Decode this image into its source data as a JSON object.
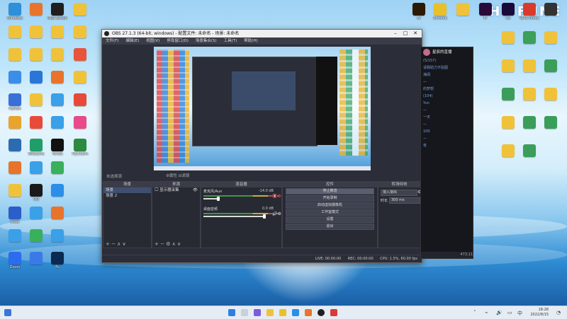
{
  "brand_text": "THE FUNE",
  "desktop_icons": [
    {
      "label": "Windows",
      "color": "#2f8fd8"
    },
    {
      "label": "",
      "color": "#e8742c"
    },
    {
      "label": "OBS Studio",
      "color": "#1f1f1f"
    },
    {
      "label": "",
      "color": "#f0c23a"
    },
    {
      "label": "",
      "color": "#f0c23a"
    },
    {
      "label": "",
      "color": "#f0c23a"
    },
    {
      "label": "",
      "color": "#f0c23a"
    },
    {
      "label": "",
      "color": "#f0c23a"
    },
    {
      "label": "",
      "color": "#f0c23a"
    },
    {
      "label": "",
      "color": "#f0c23a"
    },
    {
      "label": "",
      "color": "#f0c23a"
    },
    {
      "label": "",
      "color": "#e8553a"
    },
    {
      "label": "",
      "color": "#3a8ee8"
    },
    {
      "label": "",
      "color": "#2a76d8"
    },
    {
      "label": "",
      "color": "#e8742c"
    },
    {
      "label": "",
      "color": "#f0c23a"
    },
    {
      "label": "Python",
      "color": "#3a6fd8"
    },
    {
      "label": "",
      "color": "#f0c23a"
    },
    {
      "label": "",
      "color": "#3aa0e8"
    },
    {
      "label": "",
      "color": "#e84a3a"
    },
    {
      "label": "",
      "color": "#e8a42c"
    },
    {
      "label": "",
      "color": "#e84a3a"
    },
    {
      "label": "",
      "color": "#3aa0e8"
    },
    {
      "label": "",
      "color": "#e84a8a"
    },
    {
      "label": "",
      "color": "#2b6cb0"
    },
    {
      "label": "WeGame",
      "color": "#1f9e6a"
    },
    {
      "label": "TikTok",
      "color": "#111111"
    },
    {
      "label": "PyCharm",
      "color": "#2b8a3e"
    },
    {
      "label": "",
      "color": "#e8742c"
    },
    {
      "label": "",
      "color": "#3aa0e8"
    },
    {
      "label": "",
      "color": "#3ab05a"
    },
    {
      "label": "",
      "color": "#f0c23a"
    },
    {
      "label": "QQ",
      "color": "#1a1a1a"
    },
    {
      "label": "",
      "color": "#2b8ee8"
    },
    {
      "label": "meet",
      "color": "#2b5ec8"
    },
    {
      "label": "",
      "color": "#3aa0e8"
    },
    {
      "label": "",
      "color": "#e8742c"
    },
    {
      "label": "",
      "color": "#3aa0e8"
    },
    {
      "label": "",
      "color": "#3ab05a"
    },
    {
      "label": "",
      "color": "#3aa0e8"
    },
    {
      "label": "Zoom",
      "color": "#2b6cf0"
    },
    {
      "label": "",
      "color": "#3a7ae8"
    },
    {
      "label": "Ps",
      "color": "#0b2a52"
    },
    {
      "label": "Ai",
      "color": "#2a1a06"
    },
    {
      "label": "Chrome",
      "color": "#e8c02c"
    },
    {
      "label": "",
      "color": "#f0c23a"
    },
    {
      "label": "Pr",
      "color": "#2a0a3a"
    },
    {
      "label": "Ae",
      "color": "#1a0a3a"
    },
    {
      "label": "WPS Office",
      "color": "#d83a2c"
    },
    {
      "label": "",
      "color": "#333333"
    },
    {
      "label": "",
      "color": "#f0c23a"
    },
    {
      "label": "",
      "color": "#3aa05a"
    },
    {
      "label": "",
      "color": "#f0c23a"
    },
    {
      "label": "",
      "color": "#f0c23a"
    },
    {
      "label": "",
      "color": "#f0c23a"
    },
    {
      "label": "",
      "color": "#3a9e5a"
    },
    {
      "label": "",
      "color": "#3a9e5a"
    },
    {
      "label": "",
      "color": "#f0c23a"
    },
    {
      "label": "",
      "color": "#f0c23a"
    },
    {
      "label": "",
      "color": "#f0c23a"
    },
    {
      "label": "",
      "color": "#3a9e5a"
    },
    {
      "label": "",
      "color": "#3a9e5a"
    },
    {
      "label": "",
      "color": "#f0c23a"
    },
    {
      "label": "",
      "color": "#3a9e5a"
    }
  ],
  "obs": {
    "title": "OBS 27.1.3 (64-bit, windows) - 配置文件: 未命名 - 场景: 未命名",
    "menu": [
      "文件(F)",
      "编辑(E)",
      "视图(V)",
      "停靠窗口(D)",
      "场景集合(S)",
      "工具(T)",
      "帮助(H)"
    ],
    "no_source": "未选择源",
    "source_controls": "⚙属性  ⊟滤镜",
    "scenes_header": "场景",
    "scenes": [
      "场景",
      "场景 2"
    ],
    "sources_header": "来源",
    "sources": [
      "显示器采集"
    ],
    "mixer_header": "混音器",
    "mixer": [
      {
        "name": "麦克风/Aux",
        "db": "-14.0 dB"
      },
      {
        "name": "桌面音频",
        "db": "0.0 dB"
      }
    ],
    "controls_header": "控件",
    "controls": [
      "停止推流",
      "开始录制",
      "启动虚拟摄像机",
      "工作室模式",
      "设置",
      "退出"
    ],
    "transitions_header": "转场特效",
    "transition_select": "渐入渐出",
    "duration_label": "时长",
    "duration_value": "300 ms",
    "dock_footer": "+ −  ∧ ∨",
    "status": [
      "LIVE: 00:00:00",
      "REC: 00:00:00",
      "CPU: 1.5%, 60.00 fps"
    ]
  },
  "chat": {
    "title": "星辰的直播",
    "lines": [
      "(5/157)",
      "请我助力不贴图",
      "海阔",
      "—",
      "的梦想",
      "(104)",
      "Yun",
      "—",
      "一天",
      "—",
      "100",
      "—",
      "有"
    ],
    "footer": "473.11"
  },
  "taskbar": {
    "time": "18:28",
    "date": "2022/8/15"
  }
}
